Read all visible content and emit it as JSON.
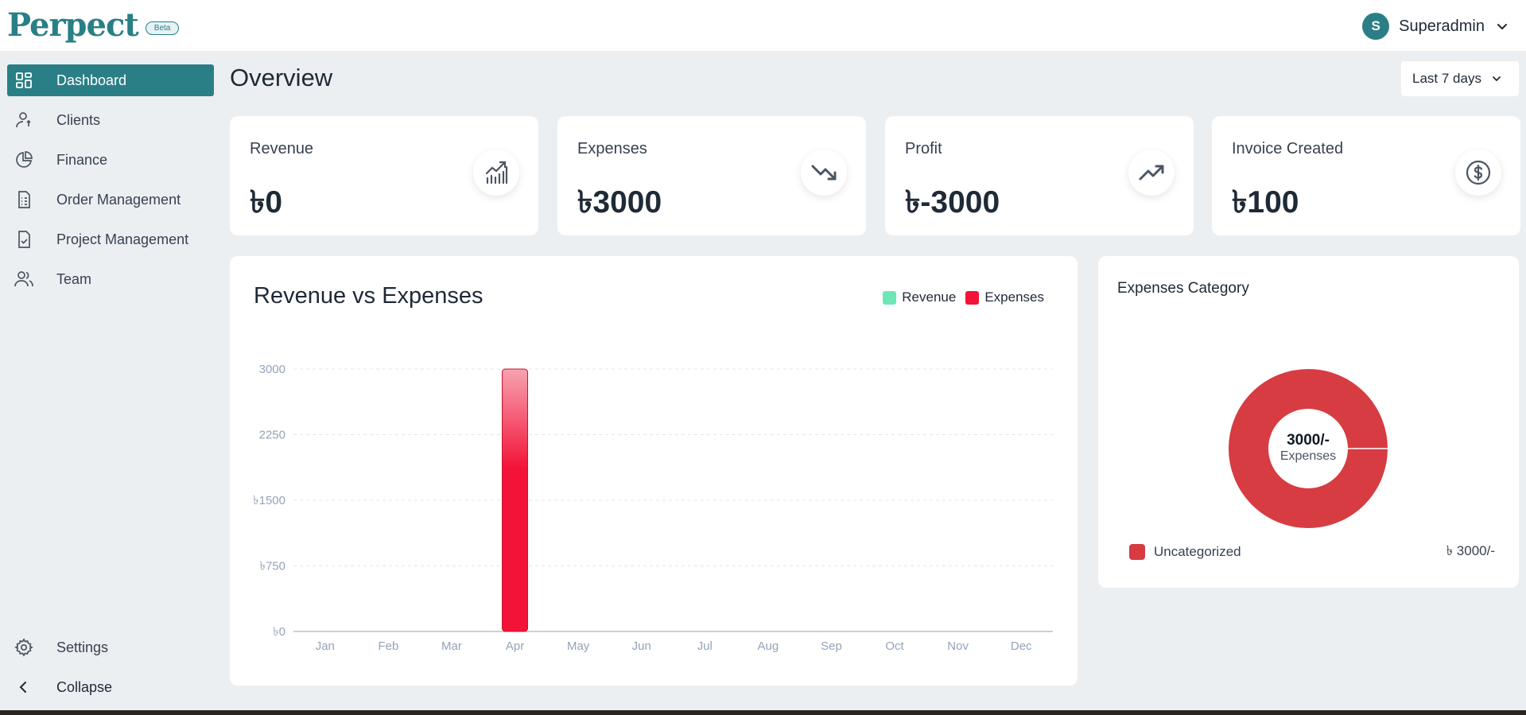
{
  "app": {
    "logo": "Perpect",
    "badge": "Beta"
  },
  "user": {
    "initial": "S",
    "name": "Superadmin"
  },
  "sidebar": {
    "items": [
      {
        "label": "Dashboard",
        "icon": "grid-icon",
        "active": true
      },
      {
        "label": "Clients",
        "icon": "user-icon"
      },
      {
        "label": "Finance",
        "icon": "pie-chart-icon"
      },
      {
        "label": "Order Management",
        "icon": "document-list-icon"
      },
      {
        "label": "Project Management",
        "icon": "document-check-icon"
      },
      {
        "label": "Team",
        "icon": "users-icon"
      }
    ],
    "settings": "Settings",
    "collapse": "Collapse"
  },
  "header": {
    "title": "Overview",
    "range": "Last 7 days"
  },
  "stats": [
    {
      "label": "Revenue",
      "value": "৳0",
      "icon": "bar-chart-trend-icon"
    },
    {
      "label": "Expenses",
      "value": "৳3000",
      "icon": "trend-down-icon"
    },
    {
      "label": "Profit",
      "value": "৳-3000",
      "icon": "trend-up-icon"
    },
    {
      "label": "Invoice Created",
      "value": "৳100",
      "icon": "dollar-circle-icon"
    }
  ],
  "chart_data": {
    "type": "bar",
    "title": "Revenue vs Expenses",
    "categories": [
      "Jan",
      "Feb",
      "Mar",
      "Apr",
      "May",
      "Jun",
      "Jul",
      "Aug",
      "Sep",
      "Oct",
      "Nov",
      "Dec"
    ],
    "series": [
      {
        "name": "Revenue",
        "color": "#6ee7b7",
        "values": [
          0,
          0,
          0,
          0,
          0,
          0,
          0,
          0,
          0,
          0,
          0,
          0
        ]
      },
      {
        "name": "Expenses",
        "color": "#f31238",
        "values": [
          0,
          0,
          0,
          3000,
          0,
          0,
          0,
          0,
          0,
          0,
          0,
          0
        ]
      }
    ],
    "yticks": [
      "৳0",
      "৳750",
      "৳1500",
      "2250",
      "3000"
    ],
    "ytick_values": [
      0,
      750,
      1500,
      2250,
      3000
    ],
    "ylim": [
      0,
      3000
    ],
    "legend": "top-right",
    "grid": true
  },
  "expenses_category": {
    "title": "Expenses Category",
    "center_value": "3000/-",
    "center_label": "Expenses",
    "slices": [
      {
        "label": "Uncategorized",
        "value": 3000,
        "amount": "৳ 3000/-",
        "color": "#d63c42"
      }
    ]
  }
}
